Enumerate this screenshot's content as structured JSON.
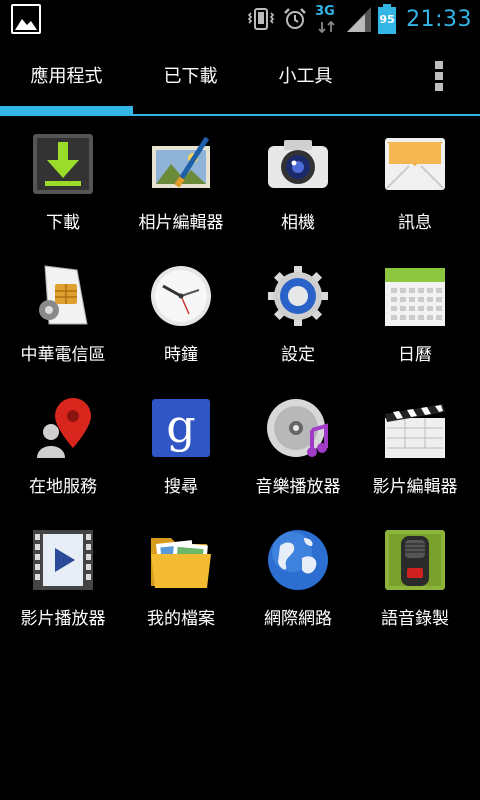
{
  "status_bar": {
    "left_icon": "gallery-notification-icon",
    "network_type": "3G",
    "battery_level": "95",
    "time": "21:33",
    "accent_color": "#33b5e5"
  },
  "tabs": [
    {
      "label": "應用程式",
      "selected": true
    },
    {
      "label": "已下載",
      "selected": false
    },
    {
      "label": "小工具",
      "selected": false
    }
  ],
  "apps": [
    {
      "label": "下載",
      "icon": "download-icon"
    },
    {
      "label": "相片編輯器",
      "icon": "photo-editor-icon"
    },
    {
      "label": "相機",
      "icon": "camera-icon"
    },
    {
      "label": "訊息",
      "icon": "messaging-icon"
    },
    {
      "label": "中華電信區",
      "icon": "sim-toolkit-icon"
    },
    {
      "label": "時鐘",
      "icon": "clock-icon"
    },
    {
      "label": "設定",
      "icon": "settings-icon"
    },
    {
      "label": "日曆",
      "icon": "calendar-icon"
    },
    {
      "label": "在地服務",
      "icon": "local-map-pin-icon"
    },
    {
      "label": "搜尋",
      "icon": "google-search-icon"
    },
    {
      "label": "音樂播放器",
      "icon": "music-player-icon"
    },
    {
      "label": "影片編輯器",
      "icon": "clapperboard-icon"
    },
    {
      "label": "影片播放器",
      "icon": "video-player-icon"
    },
    {
      "label": "我的檔案",
      "icon": "folder-icon"
    },
    {
      "label": "網際網路",
      "icon": "globe-icon"
    },
    {
      "label": "語音錄製",
      "icon": "voice-recorder-icon"
    }
  ]
}
